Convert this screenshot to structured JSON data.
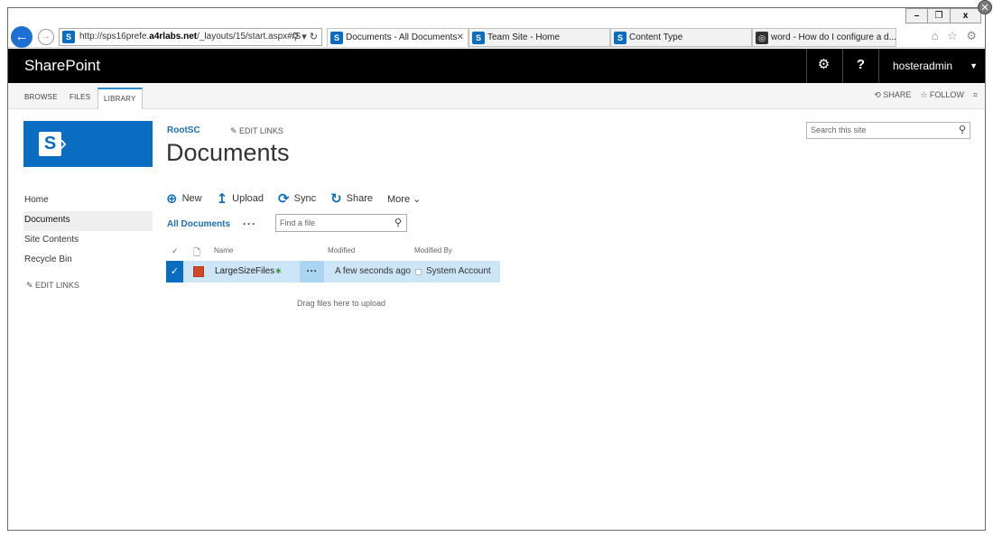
{
  "window": {
    "controls": [
      "–",
      "❐",
      "x"
    ]
  },
  "browser": {
    "address_prefix": "http://sps16prefe.",
    "address_host": "a4rlabs.net",
    "address_path": "/_layouts/15/start.aspx#/S",
    "address_icons": "⚲ ▾ ↻",
    "tabs": [
      {
        "label": "Documents - All Documents",
        "close": "✕"
      },
      {
        "label": "Team Site - Home"
      },
      {
        "label": "Content Type"
      },
      {
        "label": "word - How do I configure a d..."
      }
    ],
    "toolbar_icons": "⌂ ☆ ⚙"
  },
  "suite": {
    "brand": "SharePoint",
    "gear": "⚙",
    "help": "?",
    "user": "hosteradmin",
    "user_caret": "▼"
  },
  "ribbon": {
    "tabs": [
      "BROWSE",
      "FILES",
      "LIBRARY"
    ],
    "share": "SHARE",
    "follow": "FOLLOW",
    "focus_icon": "⌗"
  },
  "nav": {
    "items": [
      "Home",
      "Documents",
      "Site Contents",
      "Recycle Bin"
    ],
    "edit_links": "EDIT LINKS"
  },
  "breadcrumb": "RootSC",
  "edit_links": "EDIT LINKS",
  "page_title": "Documents",
  "search": {
    "placeholder": "Search this site",
    "icon": "⚲"
  },
  "commands": [
    {
      "icon": "⊕",
      "label": "New"
    },
    {
      "icon": "↥",
      "label": "Upload"
    },
    {
      "icon": "⟳",
      "label": "Sync"
    },
    {
      "icon": "↻",
      "label": "Share"
    },
    {
      "icon": "",
      "label": "More ⌄"
    }
  ],
  "view": {
    "name": "All Documents",
    "more": "···"
  },
  "find": {
    "placeholder": "Find a file",
    "icon": "⚲"
  },
  "list": {
    "headers": {
      "check": "✓",
      "type": "🗋",
      "name": "Name",
      "modified": "Modified",
      "modified_by": "Modified By"
    },
    "rows": [
      {
        "check": "✓",
        "name": "LargeSizeFiles",
        "new": "✱",
        "ellipsis": "···",
        "modified": "A few seconds ago",
        "modified_by": "System Account"
      }
    ]
  },
  "dropzone": "Drag files here to upload"
}
